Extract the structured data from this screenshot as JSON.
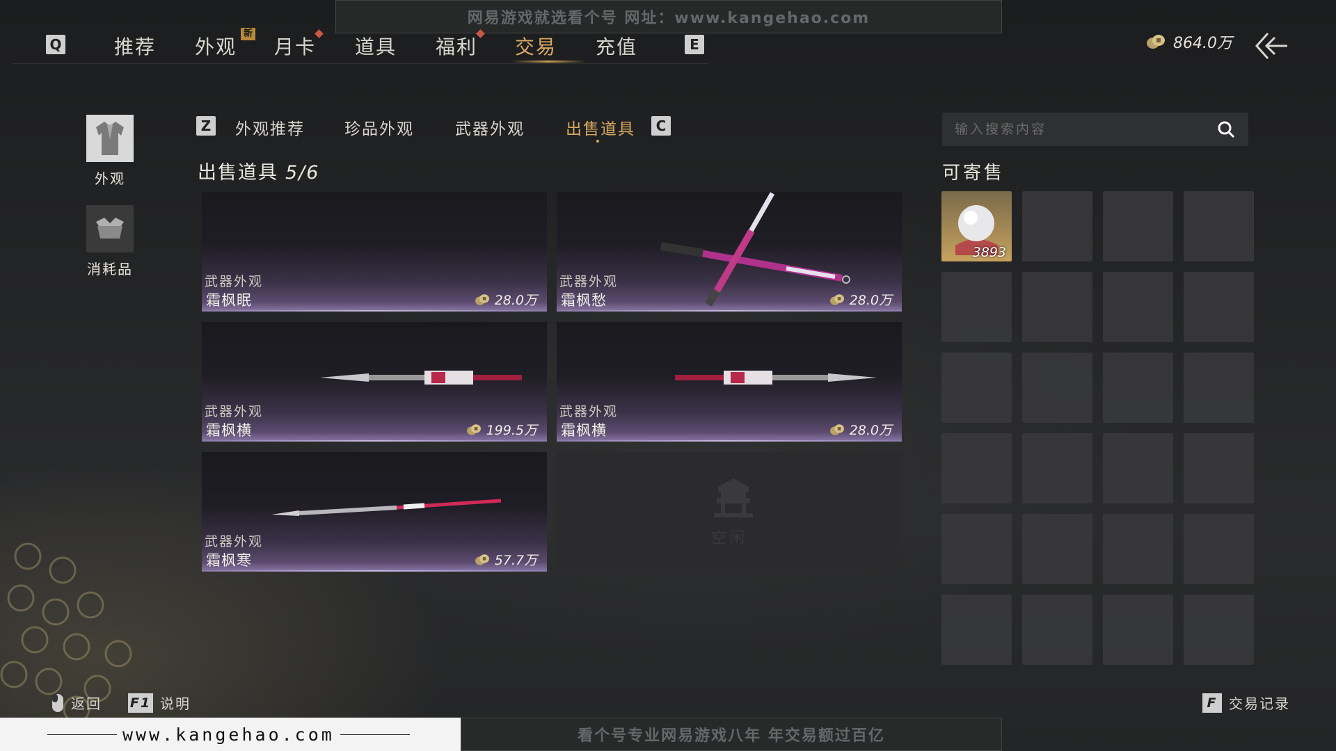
{
  "watermark": {
    "top": "网易游戏就选看个号   网址：www.kangehao.com",
    "bottom_url": "www.kangehao.com",
    "bottom": "看个号专业网易游戏八年   年交易额过百亿"
  },
  "topnav": {
    "key_left": "Q",
    "key_right": "E",
    "items": [
      {
        "label": "推荐"
      },
      {
        "label": "外观",
        "badge": "新"
      },
      {
        "label": "月卡"
      },
      {
        "label": "道具"
      },
      {
        "label": "福利"
      },
      {
        "label": "交易",
        "active": true
      },
      {
        "label": "充值"
      }
    ]
  },
  "currency": {
    "amount": "864.0万",
    "icon": "coin-icon"
  },
  "categories": [
    {
      "label": "外观",
      "icon": "outfit-icon",
      "active": true
    },
    {
      "label": "消耗品",
      "icon": "consumable-icon"
    }
  ],
  "subtabs": {
    "key_left": "Z",
    "key_right": "C",
    "items": [
      {
        "label": "外观推荐"
      },
      {
        "label": "珍品外观"
      },
      {
        "label": "武器外观"
      },
      {
        "label": "出售道具",
        "active": true
      }
    ]
  },
  "section": {
    "title": "出售道具",
    "count": "5/6"
  },
  "listings": [
    {
      "type": "武器外观",
      "name": "霜枫眠",
      "price": "28.0万"
    },
    {
      "type": "武器外观",
      "name": "霜枫愁",
      "price": "28.0万"
    },
    {
      "type": "武器外观",
      "name": "霜枫横",
      "price": "199.5万"
    },
    {
      "type": "武器外观",
      "name": "霜枫横",
      "price": "28.0万"
    },
    {
      "type": "武器外观",
      "name": "霜枫寒",
      "price": "57.7万"
    }
  ],
  "empty_slot": {
    "label": "空闲"
  },
  "search": {
    "placeholder": "输入搜索内容"
  },
  "sellable": {
    "title": "可寄售",
    "items": [
      {
        "icon": "pearl-icon",
        "qty": "3893"
      }
    ],
    "total_slots": 24
  },
  "footer": {
    "back": "返回",
    "help_key": "F1",
    "help": "说明",
    "records_key": "F",
    "records": "交易记录"
  },
  "colors": {
    "accent": "#d8a863",
    "card_glow": "#8b78a8",
    "badge": "#b88a3a",
    "red_dot": "#c85a45"
  }
}
